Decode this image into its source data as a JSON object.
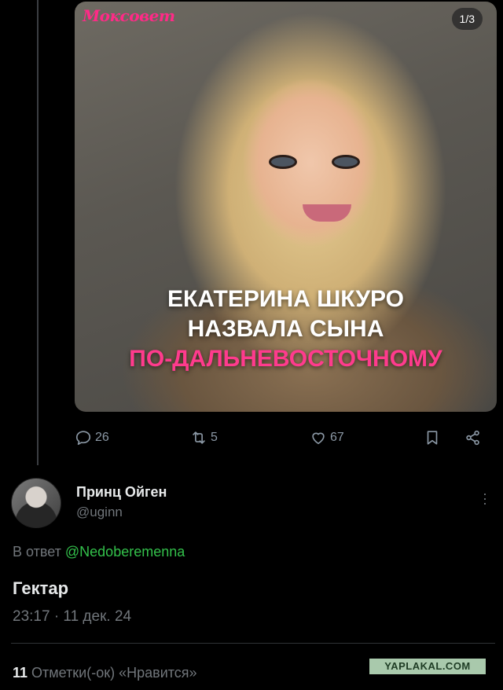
{
  "media": {
    "brand": "Мокcовет",
    "counter": "1/3",
    "headline_line1": "ЕКАТЕРИНА ШКУРО",
    "headline_line2": "НАЗВАЛА СЫНА",
    "headline_line3": "ПО-ДАЛЬНЕВОСТОЧНОМУ"
  },
  "actions": {
    "replies": "26",
    "reposts": "5",
    "likes": "67"
  },
  "reply_tweet": {
    "display_name": "Принц Ойген",
    "handle": "@uginn",
    "reply_prefix": "В ответ ",
    "reply_to": "@Nedoberemenna",
    "text": "Гектар",
    "timestamp": "23:17 · 11 дек. 24",
    "likes_count": "11",
    "likes_label": " Отметки(-ок) «Нравится»"
  },
  "watermark": "YAPLAKAL.COM",
  "colors": {
    "background": "#000000",
    "text": "#e7e9ea",
    "muted": "#71767b",
    "mention": "#33c14b",
    "headline_accent": "#ff3b8d"
  }
}
